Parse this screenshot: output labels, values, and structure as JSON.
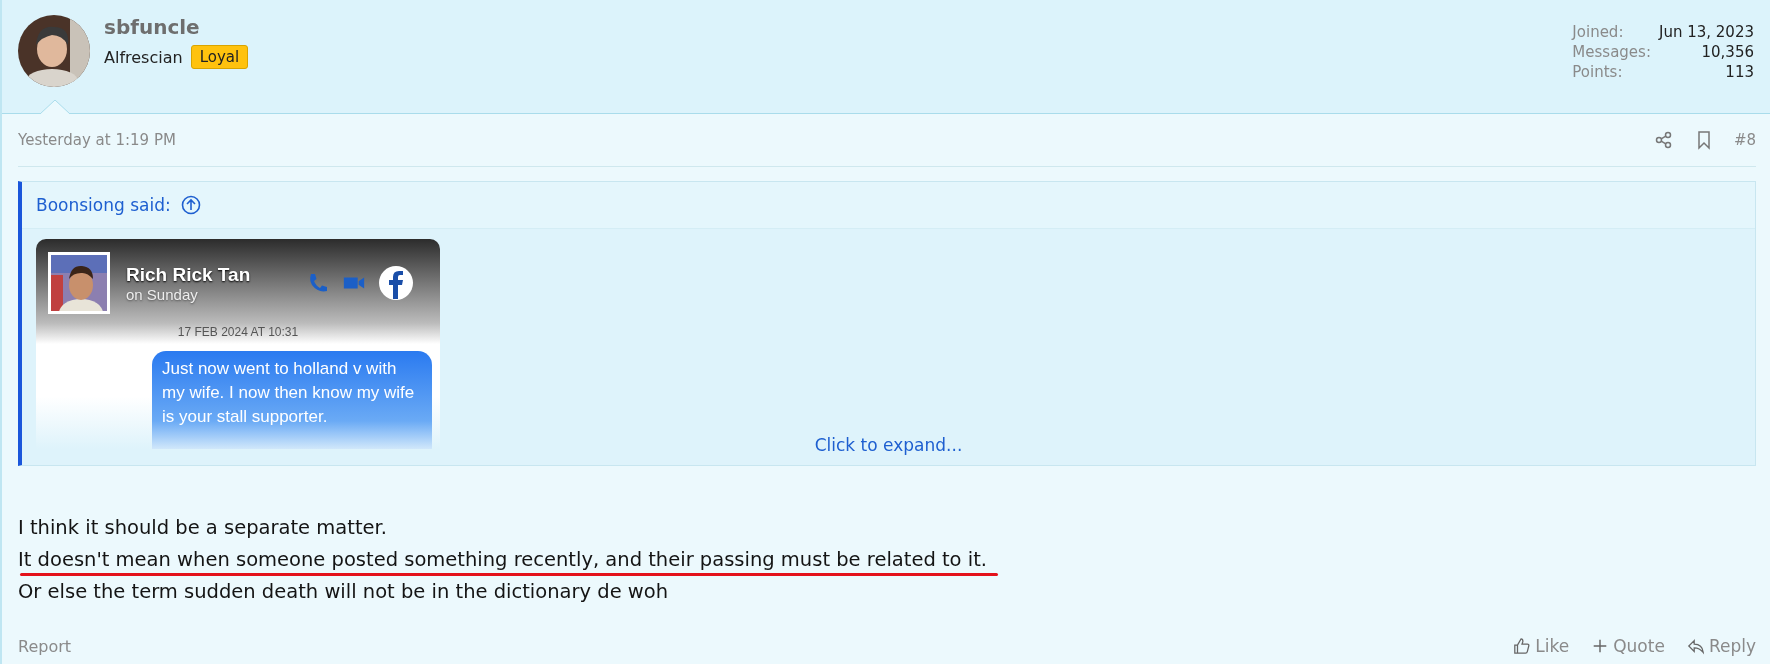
{
  "author": {
    "name": "sbfuncle",
    "title": "Alfrescian",
    "badge": "Loyal",
    "stats": [
      {
        "label": "Joined:",
        "value": "Jun 13, 2023"
      },
      {
        "label": "Messages:",
        "value": "10,356"
      },
      {
        "label": "Points:",
        "value": "113"
      }
    ]
  },
  "post": {
    "time": "Yesterday at 1:19 PM",
    "number": "#8",
    "quote": {
      "attribution": "Boonsiong said:",
      "screenshot": {
        "contact": "Rich Rick Tan",
        "subtitle": "on Sunday",
        "date": "17 FEB 2024 AT 10:31",
        "message": "Just now went to holland v with my wife. I now then know my wife is your stall supporter."
      },
      "expand": "Click to expand..."
    },
    "body": [
      {
        "text": "I think it should be a separate matter.",
        "underlined": false
      },
      {
        "text": "It doesn't mean when someone posted something recently, and their passing must be related to it.",
        "underlined": true
      },
      {
        "text": "Or else the term sudden death will not be in the dictionary de woh",
        "underlined": false
      }
    ],
    "report": "Report",
    "actions": [
      {
        "kind": "like",
        "label": "Like"
      },
      {
        "kind": "quote",
        "label": "Quote"
      },
      {
        "kind": "reply",
        "label": "Reply"
      }
    ]
  }
}
